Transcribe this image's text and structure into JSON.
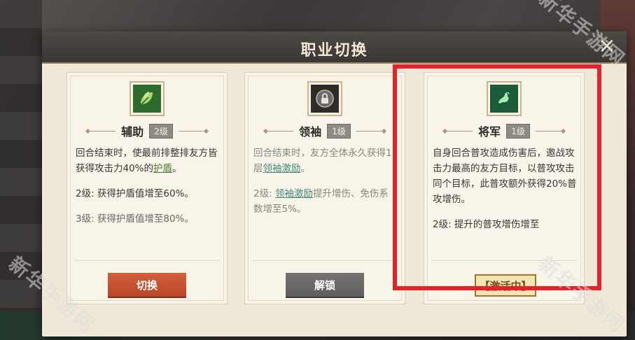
{
  "dialog": {
    "title": "职业切换",
    "close_symbol": "×"
  },
  "cards": [
    {
      "role": "辅助",
      "level": "2级",
      "icon": "leaf-icon",
      "desc_line1": "回合结束时，使最前排整排友方皆获得攻击力40%的",
      "desc_link": "护盾",
      "desc_tail": "。",
      "level2": "2级: 获得护盾值增至60%。",
      "level3": "3级: 获得护盾值增至80%。",
      "button": "切换"
    },
    {
      "role": "领袖",
      "level": "1级",
      "icon": "lock-icon",
      "desc_line1": "回合结束时，友方全体永久获得1层",
      "desc_link": "领袖激励",
      "desc_tail": "。",
      "level2_prefix": "2级: ",
      "level2_link": "领袖激励",
      "level2_suffix": "提升增伤、免伤系数增至5%。",
      "button": "解锁"
    },
    {
      "role": "将军",
      "level": "1级",
      "icon": "dragon-icon",
      "desc": "自身回合普攻造成伤害后，邀战攻击力最高的友方目标，以普攻攻击同个目标，此普攻额外获得20%普攻增伤。",
      "level2": "2级: 提升的普攻增伤增至",
      "status": "【激活中】"
    }
  ],
  "watermark": "新华手游网",
  "highlight_color": "#e2232a"
}
